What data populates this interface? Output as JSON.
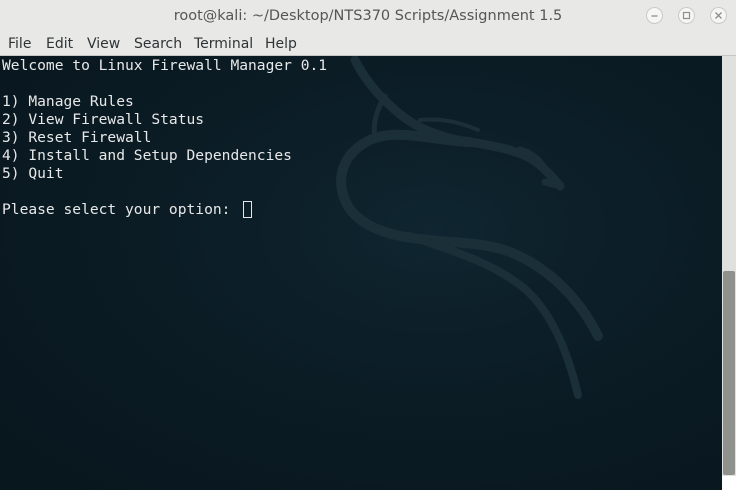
{
  "window": {
    "title": "root@kali: ~/Desktop/NTS370 Scripts/Assignment 1.5",
    "buttons": {
      "minimize": "–",
      "maximize": "□",
      "close": "×"
    }
  },
  "menubar": {
    "items": [
      "File",
      "Edit",
      "View",
      "Search",
      "Terminal",
      "Help"
    ]
  },
  "terminal": {
    "welcome": "Welcome to Linux Firewall Manager 0.1",
    "options": [
      "1) Manage Rules",
      "2) View Firewall Status",
      "3) Reset Firewall",
      "4) Install and Setup Dependencies",
      "5) Quit"
    ],
    "prompt": "Please select your option: "
  },
  "colors": {
    "terminal_bg": "#0b1c25",
    "terminal_text": "#e8e8e8",
    "titlebar_bg": "#e8e8e7"
  }
}
